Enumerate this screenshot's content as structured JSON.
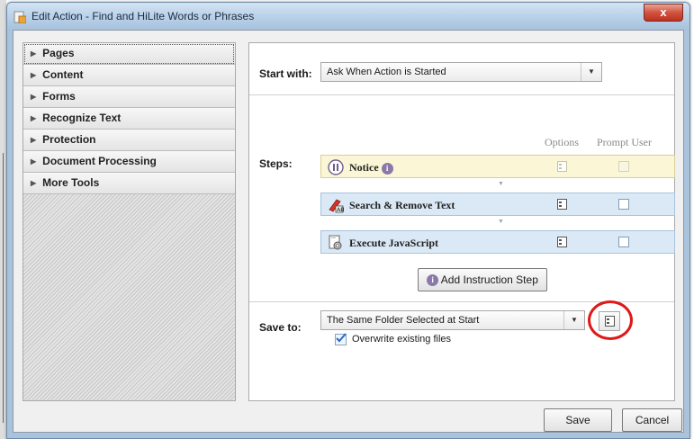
{
  "window": {
    "title": "Edit Action - Find and HiLite Words or Phrases",
    "close_label": "x"
  },
  "nav": {
    "items": [
      {
        "label": "Pages"
      },
      {
        "label": "Content"
      },
      {
        "label": "Forms"
      },
      {
        "label": "Recognize Text"
      },
      {
        "label": "Protection"
      },
      {
        "label": "Document Processing"
      },
      {
        "label": "More Tools"
      }
    ]
  },
  "start_with": {
    "label": "Start with:",
    "value": "Ask When Action is Started"
  },
  "steps": {
    "label": "Steps:",
    "options_header": "Options",
    "prompt_header": "Prompt User",
    "items": [
      {
        "label": "Notice",
        "icon": "pause-icon",
        "options_enabled": false,
        "prompt_enabled": false,
        "prompt_checked": false
      },
      {
        "label": "Search & Remove Text",
        "icon": "redact-icon",
        "options_enabled": true,
        "prompt_enabled": true,
        "prompt_checked": false
      },
      {
        "label": "Execute JavaScript",
        "icon": "javascript-gear-icon",
        "options_enabled": true,
        "prompt_enabled": true,
        "prompt_checked": false
      }
    ],
    "add_button_label": "Add Instruction Step"
  },
  "save_to": {
    "label": "Save to:",
    "value": "The Same Folder Selected at Start"
  },
  "overwrite": {
    "label": "Overwrite existing files",
    "checked": true
  },
  "footer": {
    "save_label": "Save",
    "cancel_label": "Cancel"
  },
  "colors": {
    "annotation": "#e01818",
    "notice_row": "#fbf7d6",
    "step_row": "#dae9f5",
    "info_icon": "#8a79a8"
  }
}
